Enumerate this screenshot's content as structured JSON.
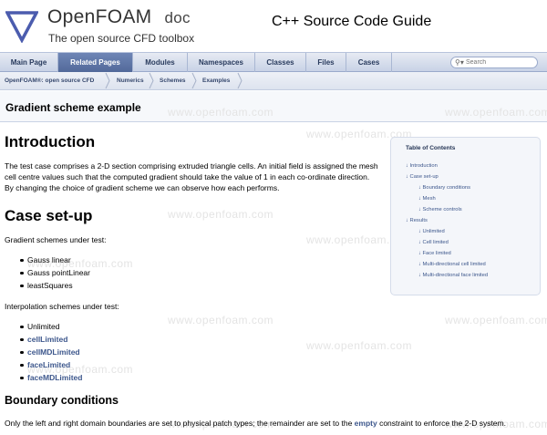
{
  "header": {
    "brand": "OpenFOAM",
    "doc": "doc",
    "tagline": "The open source CFD toolbox",
    "guide": "C++ Source Code Guide"
  },
  "nav": {
    "tabs": [
      "Main Page",
      "Related Pages",
      "Modules",
      "Namespaces",
      "Classes",
      "Files",
      "Cases"
    ],
    "active": "Related Pages",
    "search_placeholder": "Search"
  },
  "breadcrumb": [
    "OpenFOAM®: open source CFD",
    "Numerics",
    "Schemes",
    "Examples"
  ],
  "page_title": "Gradient scheme example",
  "watermark": "www.openfoam.com",
  "intro": {
    "heading": "Introduction",
    "text": "The test case comprises a 2-D section comprising extruded triangle cells. An initial field is assigned the mesh cell centre values such that the computed gradient should take the value of 1 in each co-ordinate direction. By changing the choice of gradient scheme we can observe how each performs."
  },
  "setup": {
    "heading": "Case set-up",
    "gradient_label": "Gradient schemes under test:",
    "gradient_schemes": [
      "Gauss linear",
      "Gauss pointLinear",
      "leastSquares"
    ],
    "interp_label": "Interpolation schemes under test:",
    "interp_schemes": [
      "Unlimited",
      "cellLimited",
      "cellMDLimited",
      "faceLimited",
      "faceMDLimited"
    ]
  },
  "boundary": {
    "heading": "Boundary conditions",
    "text_before": "Only the left and right domain boundaries are set to physical patch types; the remainder are set to the ",
    "link": "empty",
    "text_after": " constraint to enforce the 2-D system."
  },
  "toc": {
    "title": "Table of Contents",
    "items": [
      "Introduction",
      "Case set-up",
      "Boundary conditions",
      "Mesh",
      "Scheme controls",
      "Results",
      "Unlimited",
      "Cell limited",
      "Face limited",
      "Multi-directional cell limited",
      "Multi-directional face limited"
    ]
  },
  "colors": {
    "link": "#3d578c",
    "nav_active": "#5f76a8",
    "logo": "#4b5cae"
  }
}
